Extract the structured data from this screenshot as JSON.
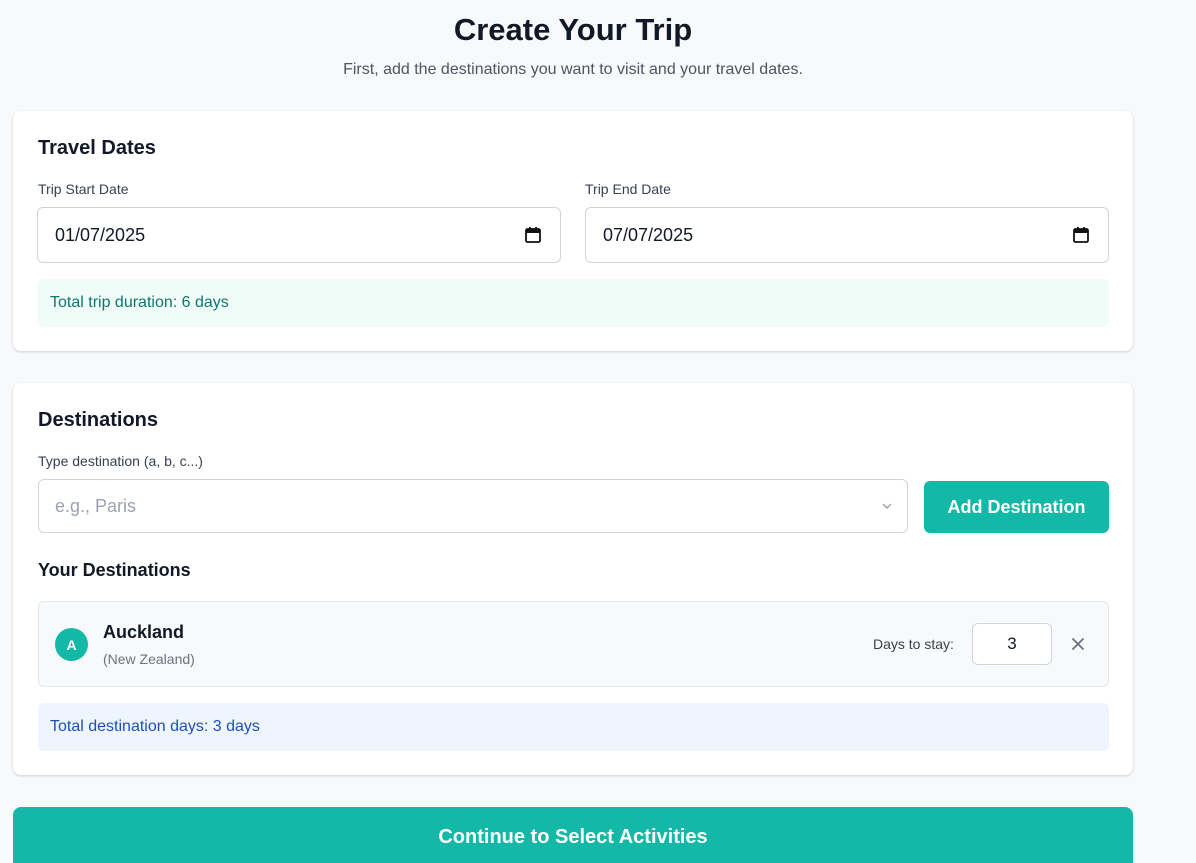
{
  "header": {
    "title": "Create Your Trip",
    "subtitle": "First, add the destinations you want to visit and your travel dates."
  },
  "travel_dates": {
    "title": "Travel Dates",
    "start": {
      "label": "Trip Start Date",
      "value": "01/07/2025"
    },
    "end": {
      "label": "Trip End Date",
      "value": "07/07/2025"
    },
    "duration_text": "Total trip duration: 6 days",
    "icon": "calendar-icon"
  },
  "destinations": {
    "title": "Destinations",
    "input_label": "Type destination (a, b, c...)",
    "input_placeholder": "e.g., Paris",
    "add_button": "Add Destination",
    "list_title": "Your Destinations",
    "items": [
      {
        "badge": "A",
        "name": "Auckland",
        "country": "(New Zealand)",
        "stay_label": "Days to stay:",
        "days": "3"
      }
    ],
    "total_text": "Total destination days: 3 days"
  },
  "continue_button": "Continue to Select Activities",
  "colors": {
    "accent": "#14b8a6",
    "success_bg": "#effcf7",
    "success_text": "#0f766e",
    "info_bg": "#eff5ff",
    "info_text": "#1e4fb8"
  }
}
